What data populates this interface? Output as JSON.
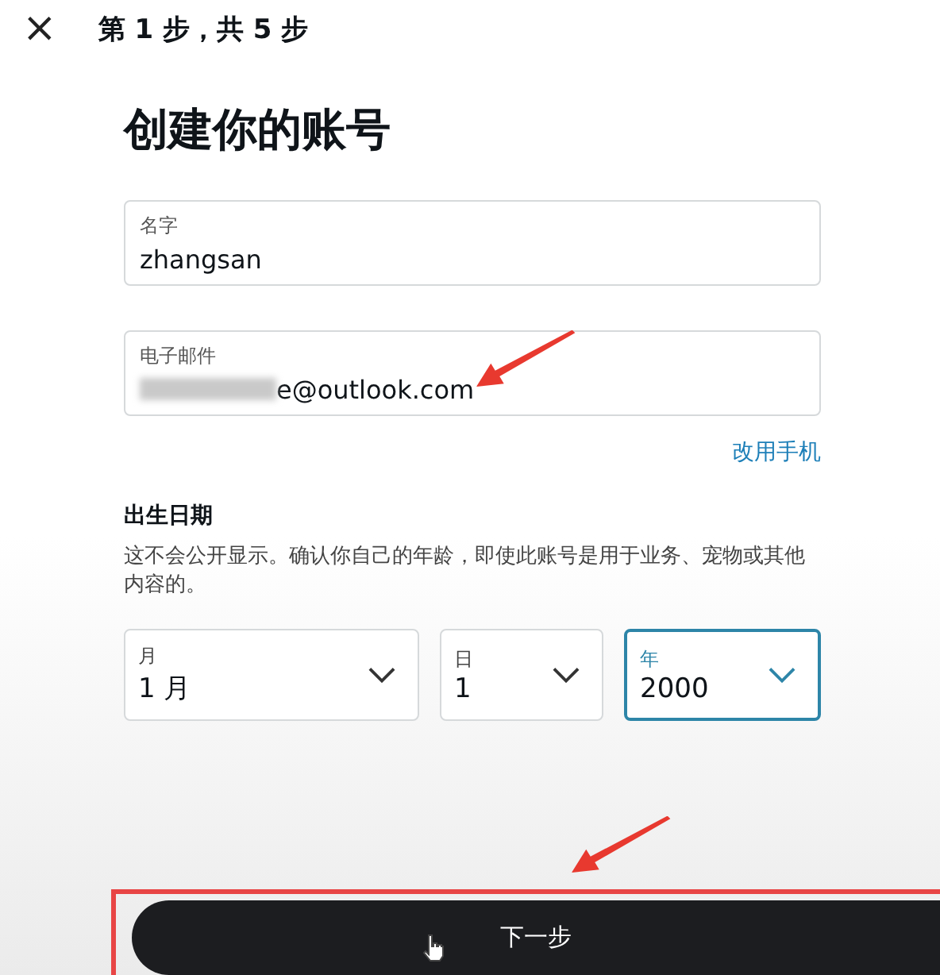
{
  "header": {
    "close": "×",
    "step": "第 1 步，共 5 步"
  },
  "title": "创建你的账号",
  "fields": [
    {
      "label": "名字",
      "value": "zhangsan",
      "redacted": false
    },
    {
      "label": "电子邮件",
      "value": "e@outlook.com",
      "redacted": true
    }
  ],
  "switch_link": "改用手机",
  "birth": {
    "heading": "出生日期",
    "note": "这不会公开显示。确认你自己的年龄，即使此账号是用于业务、宠物或其他内容的。",
    "selects": [
      {
        "label": "月",
        "value": "1 月",
        "focused": false
      },
      {
        "label": "日",
        "value": "1",
        "focused": false
      },
      {
        "label": "年",
        "value": "2000",
        "focused": true
      }
    ]
  },
  "next_button": {
    "label": "下一步",
    "highlighted": true
  }
}
